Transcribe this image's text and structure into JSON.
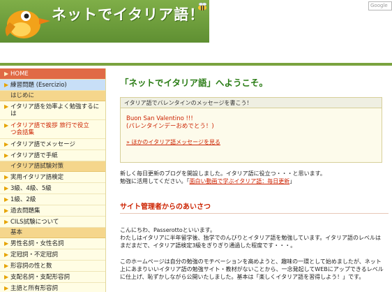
{
  "header": {
    "title": "ネットでイタリア語！",
    "google_placeholder": "Google"
  },
  "sidebar": {
    "items": [
      {
        "label": "HOME"
      },
      {
        "label": "練習問題 (Esercizio)"
      },
      {
        "section": "はじめに"
      },
      {
        "label": "イタリア語を効率よく勉強するには"
      },
      {
        "label": "イタリア語で挨拶 旅行で役立つ会話集"
      },
      {
        "label": "イタリア語でメッセージ"
      },
      {
        "label": "イタリア語で手紙"
      },
      {
        "section": "イタリア語試験対策"
      },
      {
        "label": "実用イタリア語検定"
      },
      {
        "label": "3級、4級、5級"
      },
      {
        "label": "1級、2級"
      },
      {
        "label": "過去問題集"
      },
      {
        "label": "CILS試験について"
      },
      {
        "section": "基本"
      },
      {
        "label": "男性名詞・女性名詞"
      },
      {
        "label": "定冠詞・不定冠詞"
      },
      {
        "label": "形容詞の性と数"
      },
      {
        "label": "支配名詞・支配形容詞"
      },
      {
        "label": "主語と所有形容詞"
      }
    ]
  },
  "main": {
    "welcome": "「ネットでイタリア語」へようこそ。",
    "message_box": {
      "header": "イタリア語でバレンタインのメッセージを書こう！",
      "line1": "Buon San Valentino !!!",
      "line2": "(バレンタインデーおめでとう！)",
      "link": "» ほかのイタリア語メッセージを見る"
    },
    "news_line1": "新しく毎日更新のブログを開設しました。イタリア語に役立つ・・・と思います。",
    "news_line2_prefix": "勉強に活用してください。「",
    "news_link": "面白い動画で学ぶイタリア語：毎日更新",
    "news_line2_suffix": "」",
    "section_title": "サイト管理者からのあいさつ",
    "greeting_1": "こんにちわ、Passerottoといいます。",
    "greeting_2": "わたしはイタリアに半年留学後、独学でのんびりとイタリア語を勉強しています。イタリア語のレベルは",
    "greeting_3": "まだまだで、イタリア語検定3級をぎりぎり通過した程度です・・・。",
    "about_1": "このホームページは自分の勉強のモチベーションを高めようと、趣味の一環として始めましたが、ネット",
    "about_2": "上にあまりいいイタリア語の勉強サイト・教材がないことから、一念発起してWEBにアップできるレベル",
    "about_3": "に仕上げ、恥ずかしながら公開いたしました。基本は「楽しくイタリア語を習得しよう！」です。"
  },
  "colors": {
    "header_green": "#6d9b3a",
    "title_green": "#2b7d16",
    "accent_red": "#cc2200",
    "home_bg": "#e06a45",
    "section_bg": "#f5d68c"
  }
}
